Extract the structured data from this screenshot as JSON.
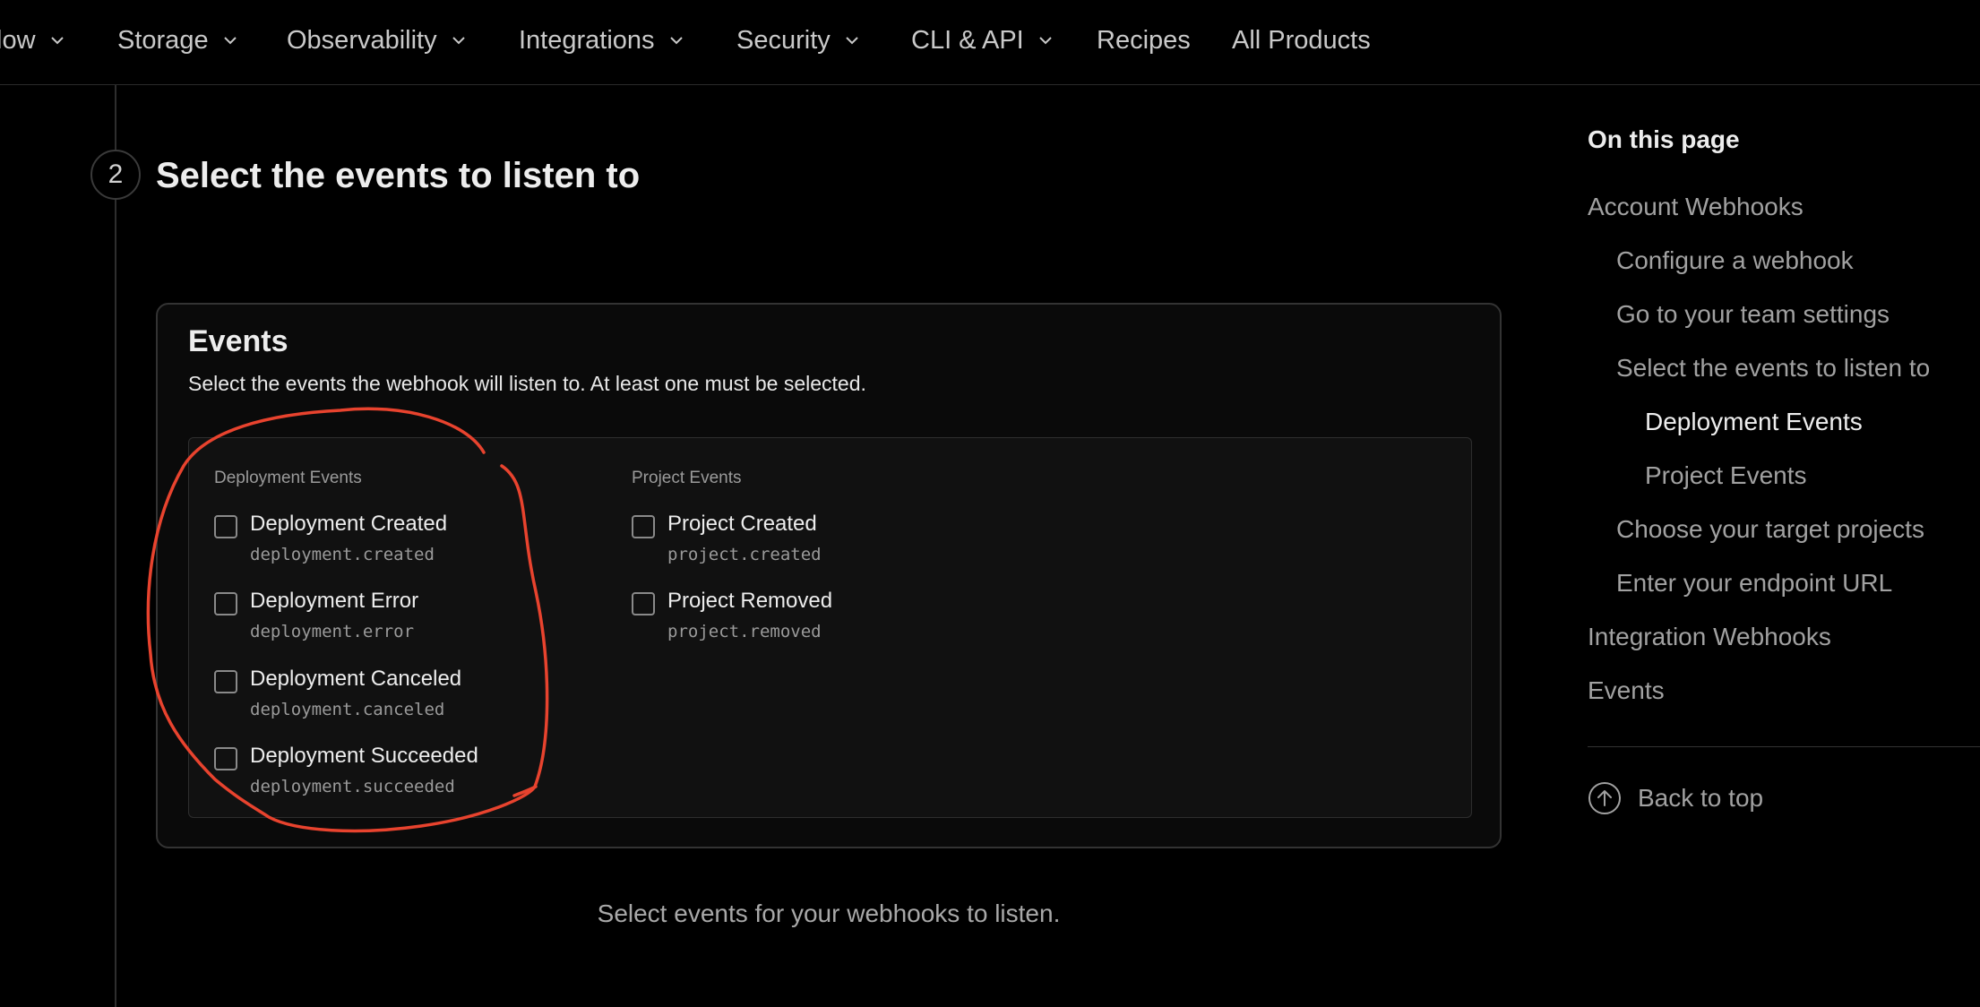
{
  "nav": {
    "items": [
      {
        "label": "low",
        "dropdown": true
      },
      {
        "label": "Storage",
        "dropdown": true
      },
      {
        "label": "Observability",
        "dropdown": true
      },
      {
        "label": "Integrations",
        "dropdown": true
      },
      {
        "label": "Security",
        "dropdown": true
      },
      {
        "label": "CLI & API",
        "dropdown": true
      },
      {
        "label": "Recipes",
        "dropdown": false
      },
      {
        "label": "All Products",
        "dropdown": false
      }
    ],
    "chevron_icon": "chevron-down-icon"
  },
  "step": {
    "number": "2",
    "title": "Select the events to listen to"
  },
  "events_card": {
    "title": "Events",
    "description": "Select the events the webhook will listen to. At least one must be selected.",
    "groups": [
      {
        "title": "Deployment Events",
        "events": [
          {
            "label": "Deployment Created",
            "code": "deployment.created",
            "checked": false
          },
          {
            "label": "Deployment Error",
            "code": "deployment.error",
            "checked": false
          },
          {
            "label": "Deployment Canceled",
            "code": "deployment.canceled",
            "checked": false
          },
          {
            "label": "Deployment Succeeded",
            "code": "deployment.succeeded",
            "checked": false
          }
        ]
      },
      {
        "title": "Project Events",
        "events": [
          {
            "label": "Project Created",
            "code": "project.created",
            "checked": false
          },
          {
            "label": "Project Removed",
            "code": "project.removed",
            "checked": false
          }
        ]
      }
    ]
  },
  "caption": "Select events for your webhooks to listen.",
  "toc": {
    "heading": "On this page",
    "items": [
      {
        "label": "Account Webhooks",
        "level": 1,
        "active": false
      },
      {
        "label": "Configure a webhook",
        "level": 2,
        "active": false
      },
      {
        "label": "Go to your team settings",
        "level": 2,
        "active": false
      },
      {
        "label": "Select the events to listen to",
        "level": 2,
        "active": false
      },
      {
        "label": "Deployment Events",
        "level": 3,
        "active": true
      },
      {
        "label": "Project Events",
        "level": 3,
        "active": false
      },
      {
        "label": "Choose your target projects",
        "level": 2,
        "active": false
      },
      {
        "label": "Enter your endpoint URL",
        "level": 2,
        "active": false
      },
      {
        "label": "Integration Webhooks",
        "level": 1,
        "active": false
      },
      {
        "label": "Events",
        "level": 1,
        "active": false
      }
    ],
    "back_to_top": "Back to top",
    "back_to_top_icon": "arrow-up-circle-icon"
  },
  "colors": {
    "background": "#000000",
    "annotation": "#e8432e",
    "text_primary": "#ededed",
    "text_muted": "#a1a1a1"
  }
}
